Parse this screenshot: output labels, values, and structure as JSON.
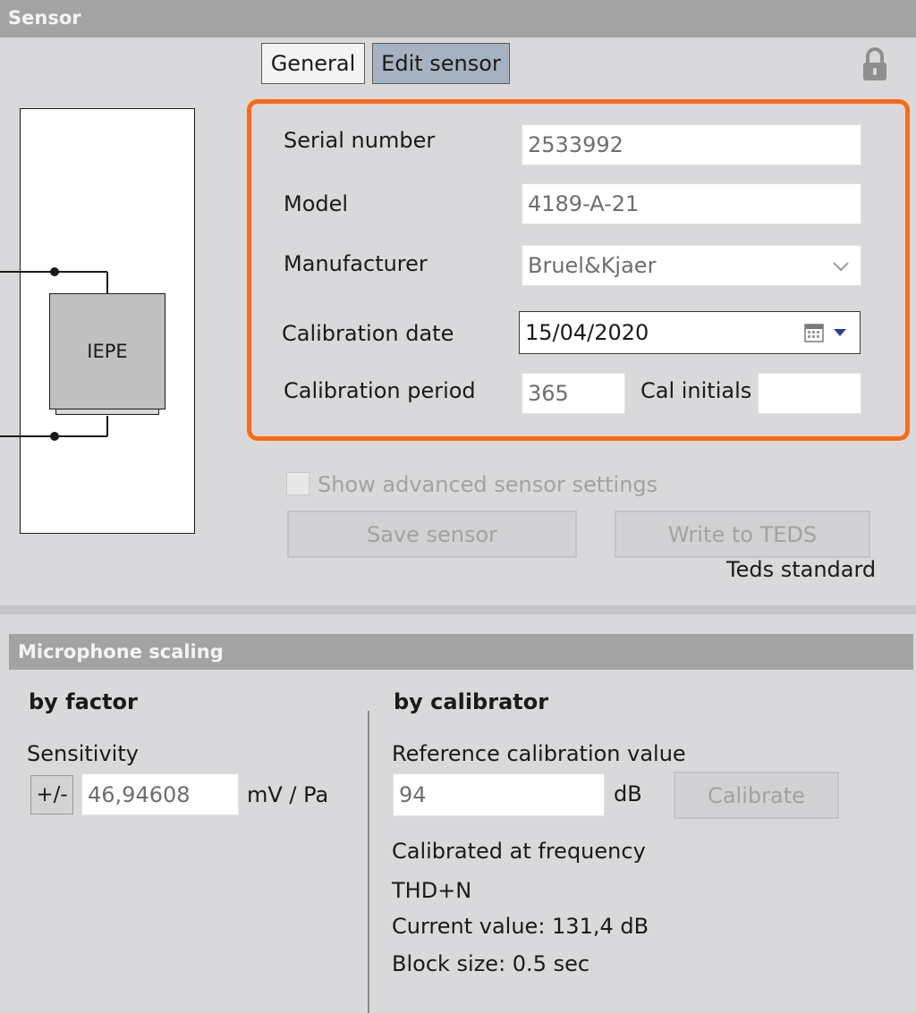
{
  "sensor_panel": {
    "header": "Sensor",
    "tabs": [
      {
        "label": "General",
        "active": false
      },
      {
        "label": "Edit sensor",
        "active": true
      }
    ],
    "diagram": {
      "box_label": "IEPE"
    },
    "form": {
      "serial_number": {
        "label": "Serial number",
        "value": "2533992"
      },
      "model": {
        "label": "Model",
        "value": "4189-A-21"
      },
      "manufacturer": {
        "label": "Manufacturer",
        "value": "Bruel&Kjaer"
      },
      "calibration_date": {
        "label": "Calibration date",
        "value": "15/04/2020"
      },
      "calibration_period": {
        "label": "Calibration period",
        "value": "365"
      },
      "cal_initials": {
        "label": "Cal initials",
        "value": ""
      }
    },
    "show_advanced_label": "Show advanced sensor settings",
    "show_advanced_checked": false,
    "save_sensor_label": "Save sensor",
    "write_teds_label": "Write to TEDS",
    "teds_standard_label": "Teds standard"
  },
  "microphone_scaling": {
    "header": "Microphone scaling",
    "by_factor": {
      "title": "by factor",
      "sensitivity_label": "Sensitivity",
      "sign_button": "+/-",
      "sensitivity_value": "46,94608",
      "unit": "mV / Pa"
    },
    "by_calibrator": {
      "title": "by calibrator",
      "reference_label": "Reference calibration value",
      "reference_value": "94",
      "reference_unit": "dB",
      "calibrate_label": "Calibrate",
      "calibrated_at_frequency": "Calibrated at frequency",
      "thd_n": "THD+N",
      "current_value": "Current value: 131,4 dB",
      "block_size": "Block size: 0.5 sec"
    }
  },
  "colors": {
    "highlight_border": "#ff6a13",
    "header_bg": "#a3a3a3",
    "panel_bg": "#d9d8da",
    "active_tab_bg": "#a7b2c0"
  }
}
